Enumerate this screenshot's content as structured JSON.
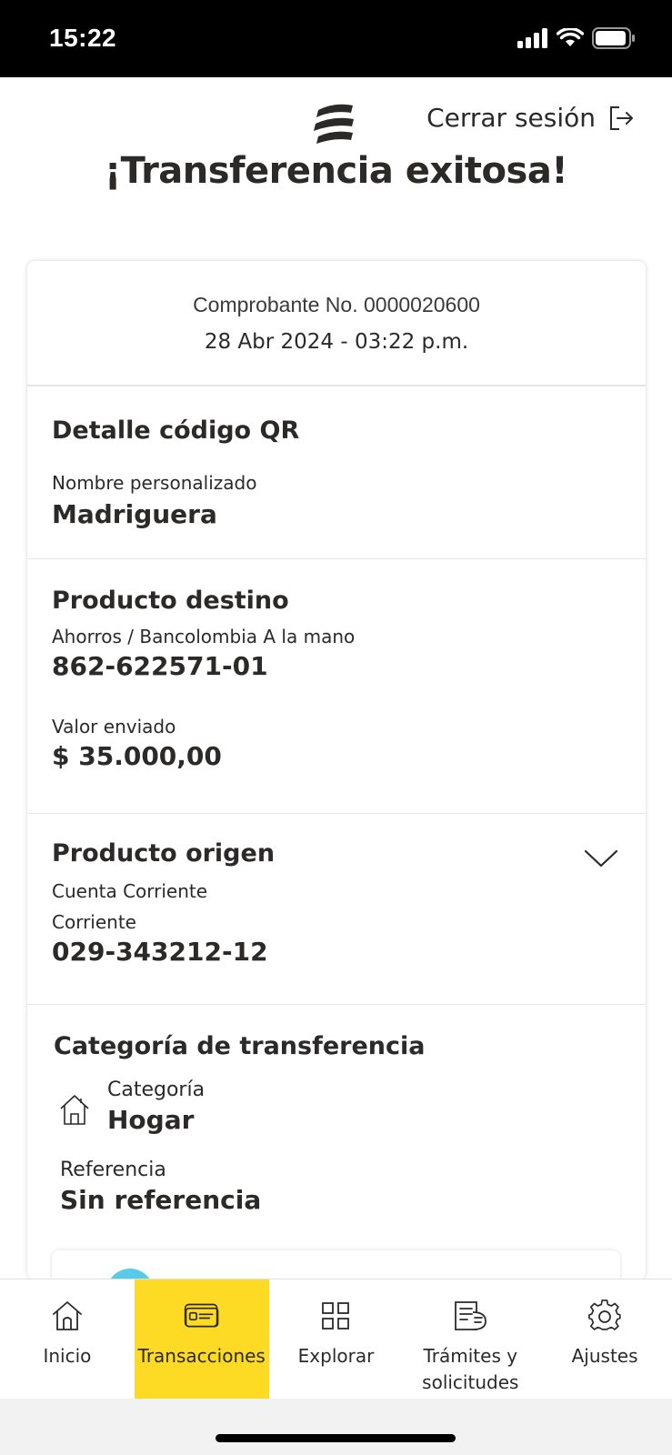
{
  "status_bar": {
    "time": "15:22"
  },
  "header": {
    "logout_label": "Cerrar sesión",
    "title": "¡Transferencia exitosa!"
  },
  "voucher": {
    "number": "Comprobante No. 0000020600",
    "date": "28 Abr 2024 - 03:22 p.m."
  },
  "qr_detail": {
    "title": "Detalle código QR",
    "name_label": "Nombre personalizado",
    "name_value": "Madriguera"
  },
  "destination": {
    "title": "Producto destino",
    "product_label": "Ahorros / Bancolombia A la mano",
    "account": "862-622571-01",
    "amount_label": "Valor enviado",
    "amount": "$ 35.000,00"
  },
  "origin": {
    "title": "Producto origen",
    "line1": "Cuenta Corriente",
    "line2": "Corriente",
    "account": "029-343212-12"
  },
  "category": {
    "title": "Categoría de transferencia",
    "category_label": "Categoría",
    "category_value": "Hogar",
    "reference_label": "Referencia",
    "reference_value": "Sin referencia"
  },
  "tabs": [
    {
      "label": "Inicio",
      "icon": "home-icon",
      "active": false
    },
    {
      "label": "Transacciones",
      "icon": "card-icon",
      "active": true
    },
    {
      "label": "Explorar",
      "icon": "grid-icon",
      "active": false
    },
    {
      "label": "Trámites y solicitudes",
      "icon": "document-icon",
      "active": false
    },
    {
      "label": "Ajustes",
      "icon": "gear-icon",
      "active": false
    }
  ],
  "colors": {
    "accent": "#fdda24",
    "text": "#2c2a29",
    "avatar": "#59cbe8"
  }
}
